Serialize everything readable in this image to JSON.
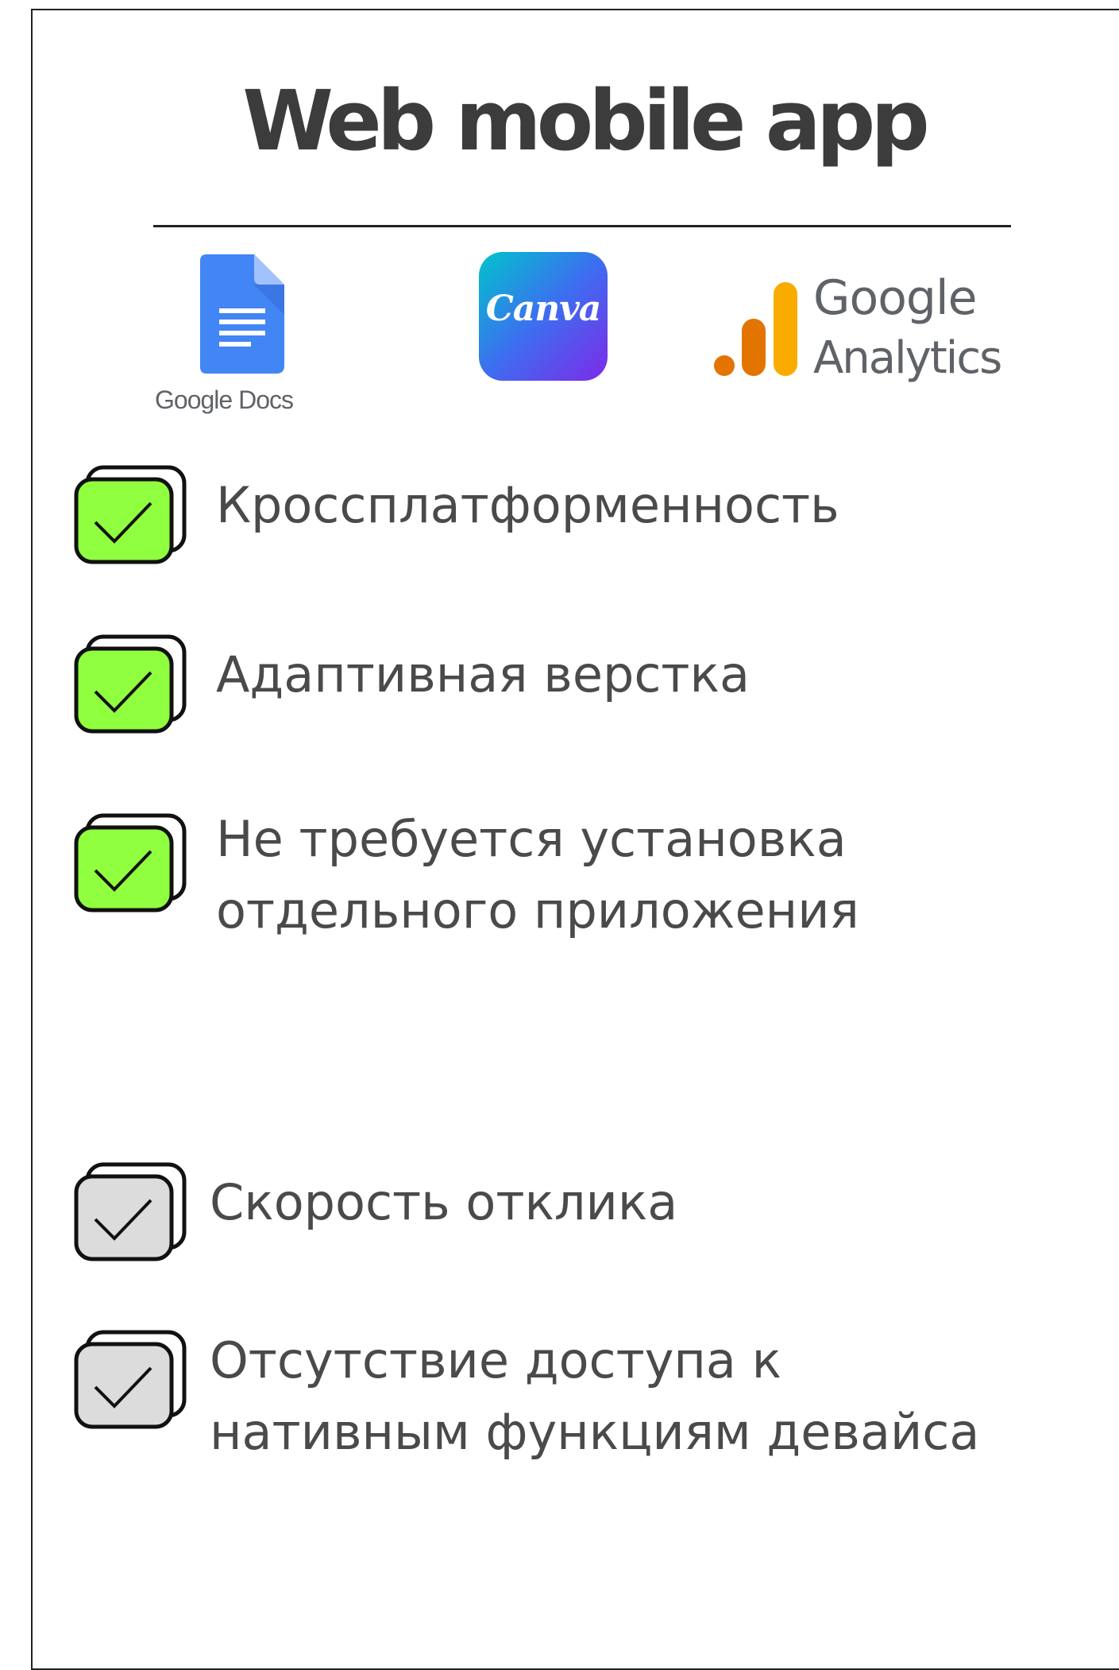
{
  "title": "Web mobile app",
  "logos": {
    "google_docs": {
      "label": "Google Docs",
      "icon": "google-docs-icon",
      "color": "#4285f4"
    },
    "canva": {
      "label": "Canva",
      "icon": "canva-icon"
    },
    "google_analytics": {
      "line1": "Google",
      "line2": "Analytics",
      "icon": "google-analytics-icon",
      "colors": [
        "#e37400",
        "#f9ab00"
      ]
    }
  },
  "colors": {
    "positive": "#8fff3f",
    "neutral": "#dcdcdc",
    "text": "#4a4a4a",
    "title": "#3c3c3c"
  },
  "pros": [
    {
      "text": "Кроссплатформенность"
    },
    {
      "text": "Адаптивная верстка"
    },
    {
      "line1": "Не требуется установка",
      "line2": "отдельного приложения"
    }
  ],
  "cons": [
    {
      "text": "Скорость отклика"
    },
    {
      "line1": "Отсутствие доступа к",
      "line2": "нативным функциям девайса"
    }
  ]
}
